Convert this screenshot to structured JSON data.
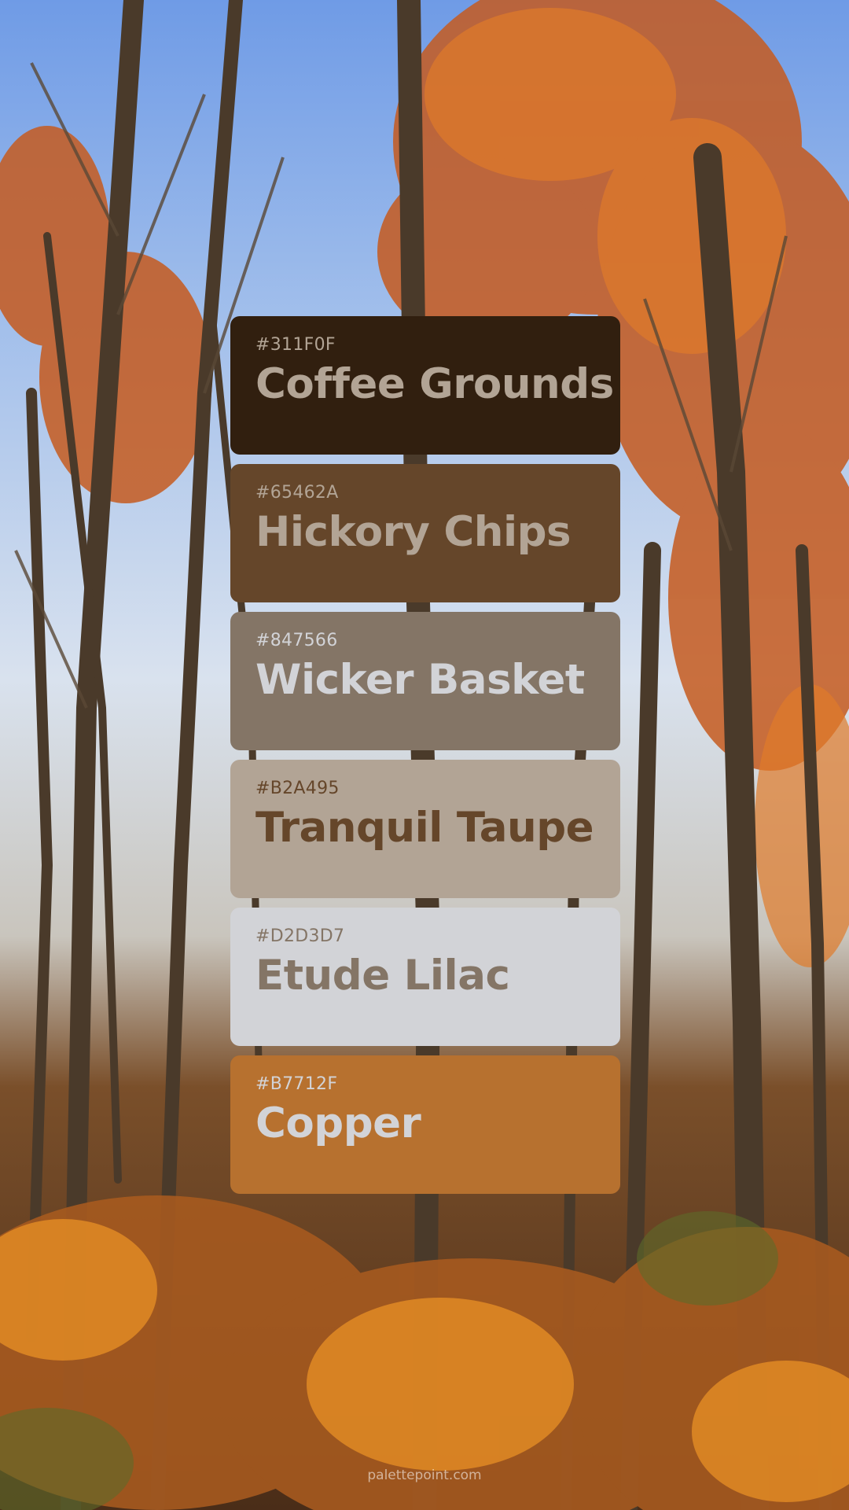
{
  "palette": {
    "colors": [
      {
        "hex": "#311F0F",
        "name": "Coffee Grounds",
        "bg": "#311F0F",
        "text": "#B2A495"
      },
      {
        "hex": "#65462A",
        "name": "Hickory Chips",
        "bg": "#65462A",
        "text": "#B2A495"
      },
      {
        "hex": "#847566",
        "name": "Wicker Basket",
        "bg": "#847566",
        "text": "#D2D3D7"
      },
      {
        "hex": "#B2A495",
        "name": "Tranquil Taupe",
        "bg": "#B2A495",
        "text": "#65462A"
      },
      {
        "hex": "#D2D3D7",
        "name": "Etude Lilac",
        "bg": "#D2D3D7",
        "text": "#847566"
      },
      {
        "hex": "#B7712F",
        "name": "Copper",
        "bg": "#B7712F",
        "text": "#D2D3D7"
      }
    ]
  },
  "footer": {
    "watermark": "palettepoint.com"
  }
}
